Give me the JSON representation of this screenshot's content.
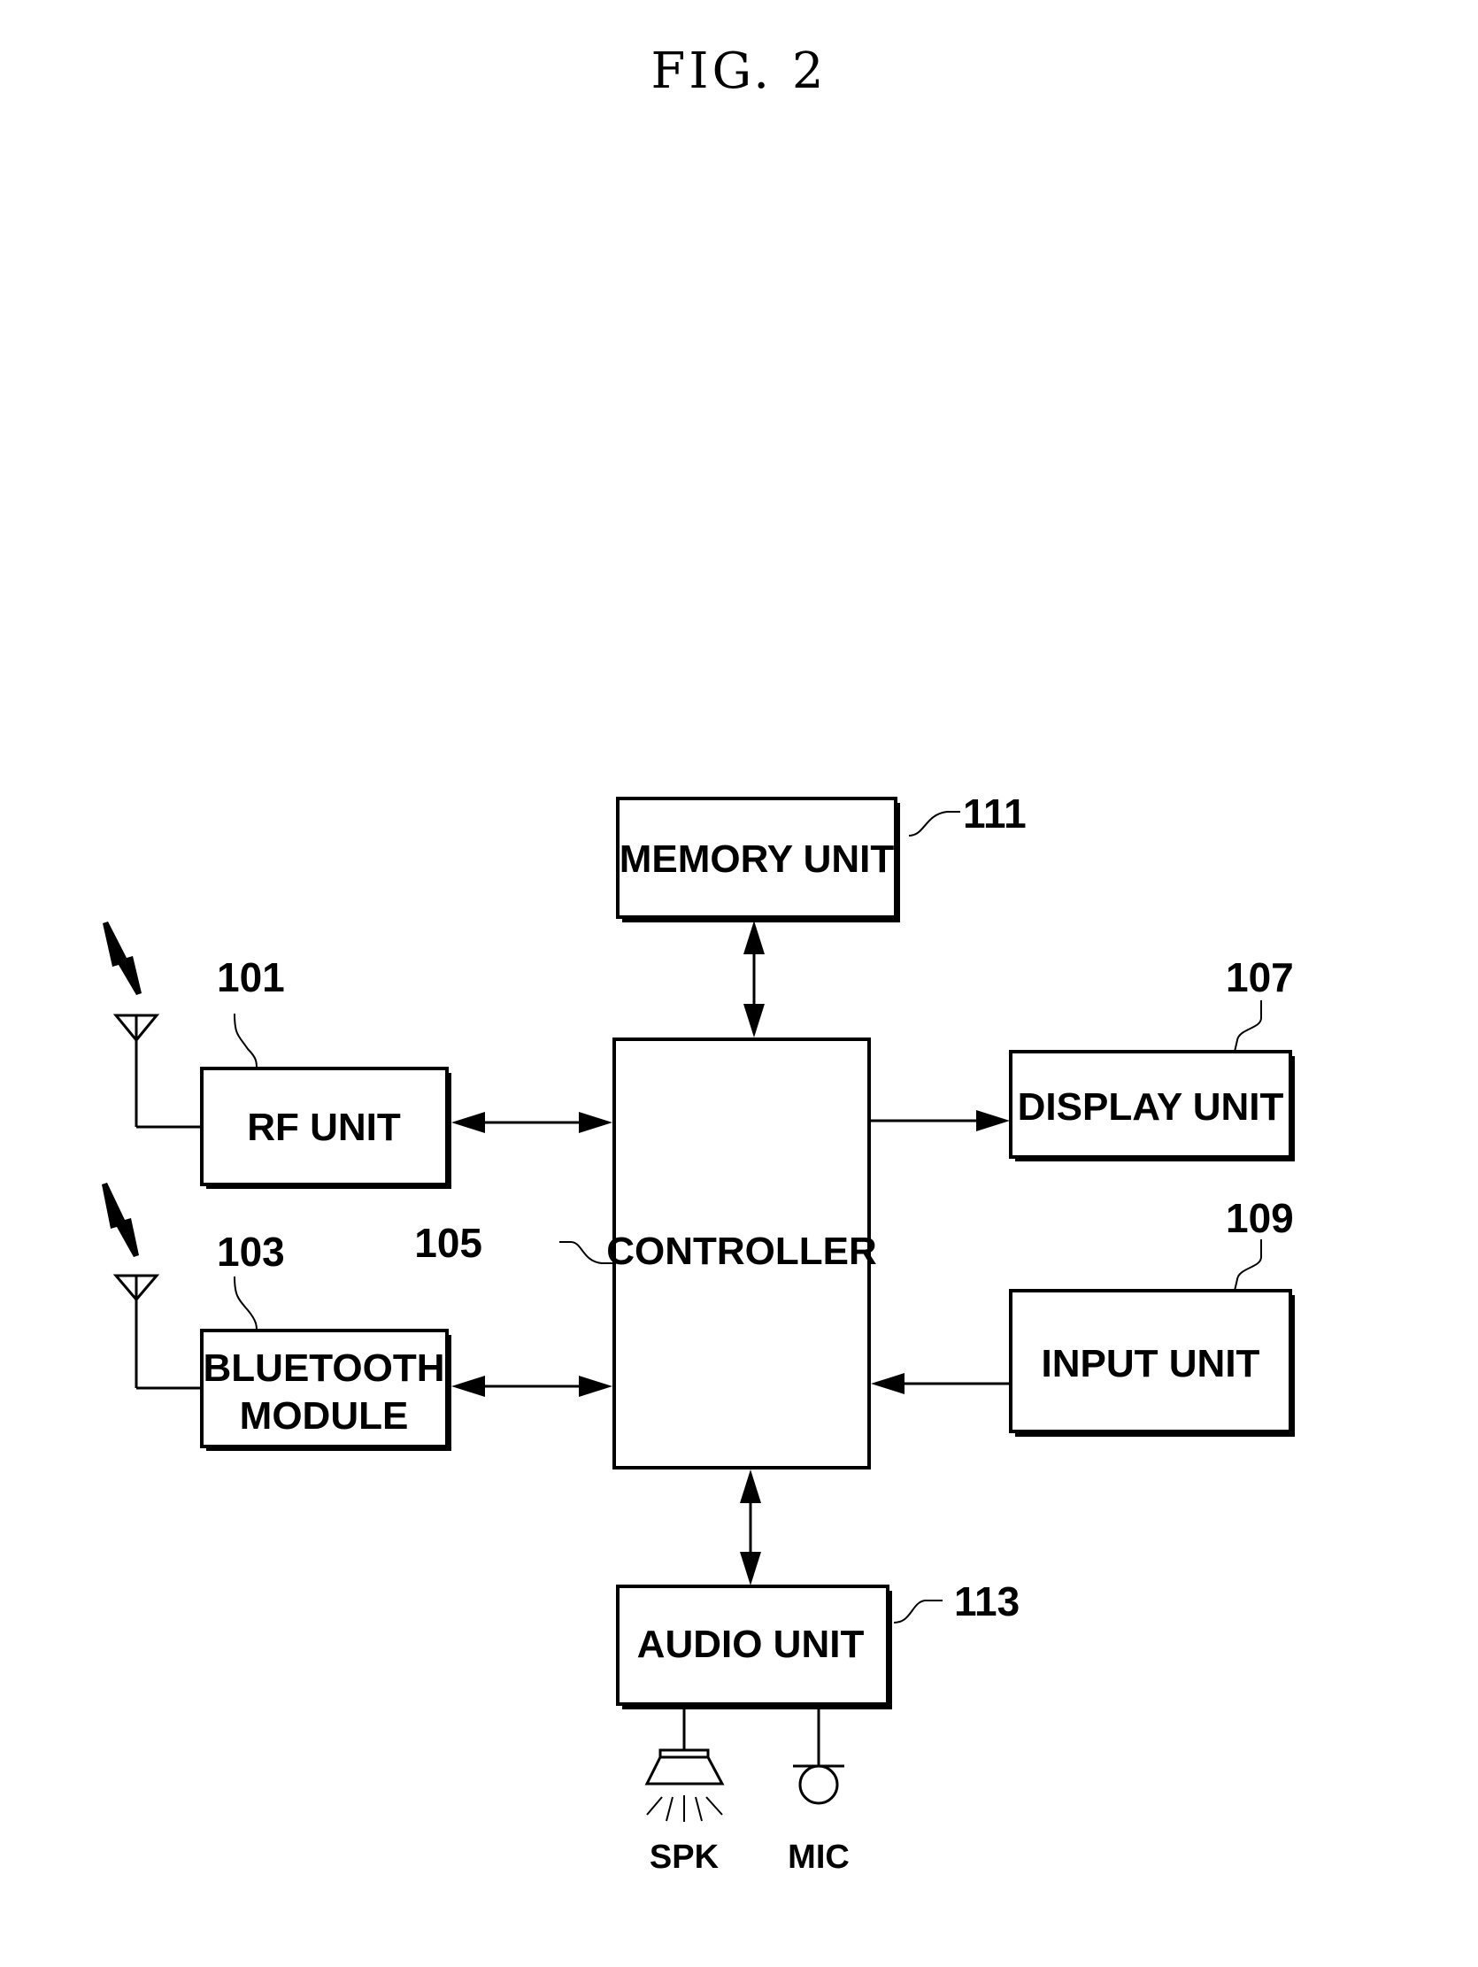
{
  "figure": {
    "title": "FIG. 2"
  },
  "blocks": {
    "memory": {
      "label": "MEMORY UNIT",
      "ref": "111"
    },
    "rf": {
      "label": "RF UNIT",
      "ref": "101"
    },
    "bluetooth": {
      "label_line1": "BLUETOOTH",
      "label_line2": "MODULE",
      "ref": "103"
    },
    "controller": {
      "label": "CONTROLLER",
      "ref": "105"
    },
    "display": {
      "label": "DISPLAY UNIT",
      "ref": "107"
    },
    "input": {
      "label": "INPUT UNIT",
      "ref": "109"
    },
    "audio": {
      "label": "AUDIO UNIT",
      "ref": "113"
    }
  },
  "peripherals": {
    "speaker": {
      "label": "SPK",
      "icon": "speaker-icon"
    },
    "microphone": {
      "label": "MIC",
      "icon": "microphone-icon"
    },
    "antenna_icon": "antenna-icon",
    "signal_icon": "lightning-signal-icon"
  },
  "connections": [
    {
      "from": "memory",
      "to": "controller",
      "direction": "bidirectional"
    },
    {
      "from": "rf",
      "to": "controller",
      "direction": "bidirectional"
    },
    {
      "from": "bluetooth",
      "to": "controller",
      "direction": "bidirectional"
    },
    {
      "from": "controller",
      "to": "display",
      "direction": "unidirectional"
    },
    {
      "from": "input",
      "to": "controller",
      "direction": "unidirectional"
    },
    {
      "from": "controller",
      "to": "audio",
      "direction": "bidirectional"
    }
  ]
}
